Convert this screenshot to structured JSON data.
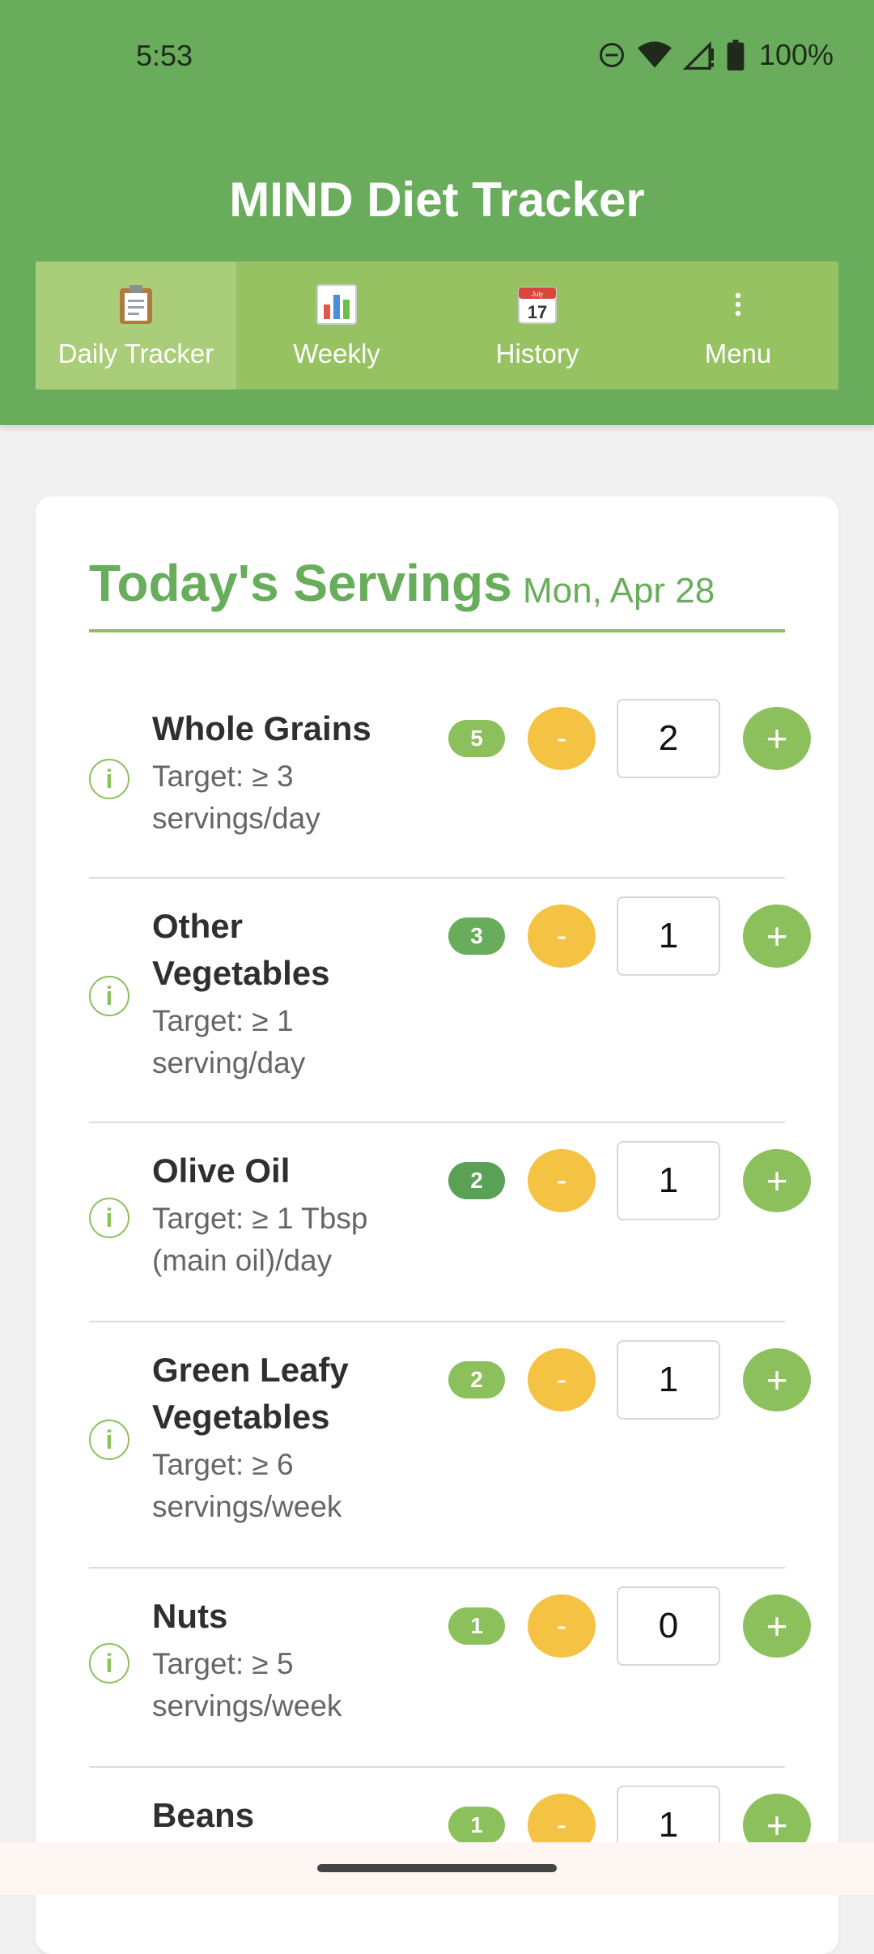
{
  "status_bar": {
    "time": "5:53",
    "battery": "100%"
  },
  "app": {
    "title": "MIND Diet Tracker"
  },
  "tabs": [
    {
      "label": "Daily Tracker",
      "icon": "clipboard-icon"
    },
    {
      "label": "Weekly",
      "icon": "bar-chart-icon"
    },
    {
      "label": "History",
      "icon": "calendar-icon",
      "calendar_month": "July",
      "calendar_day": "17"
    },
    {
      "label": "Menu",
      "icon": "more-vert-icon"
    }
  ],
  "card": {
    "title": "Today's Servings",
    "date": "Mon, Apr 28"
  },
  "foods": [
    {
      "name": "Whole Grains",
      "target": "Target: ≥ 3 servings/day",
      "badge": "5",
      "badge_color": "#8cc05c",
      "quantity": "2"
    },
    {
      "name": "Other Vegetables",
      "target": "Target: ≥ 1 serving/day",
      "badge": "3",
      "badge_color": "#68ad5c",
      "quantity": "1"
    },
    {
      "name": "Olive Oil",
      "target": "Target: ≥ 1 Tbsp (main oil)/day",
      "badge": "2",
      "badge_color": "#58a155",
      "quantity": "1"
    },
    {
      "name": "Green Leafy Vegetables",
      "target": "Target: ≥ 6 servings/week",
      "badge": "2",
      "badge_color": "#8cc05c",
      "quantity": "1"
    },
    {
      "name": "Nuts",
      "target": "Target: ≥ 5 servings/week",
      "badge": "1",
      "badge_color": "#8cc05c",
      "quantity": "0"
    },
    {
      "name": "Beans",
      "target": "",
      "badge": "1",
      "badge_color": "#8cc05c",
      "quantity": "1"
    }
  ],
  "controls": {
    "minus_label": "-",
    "plus_label": "+",
    "info_label": "i"
  },
  "colors": {
    "primary": "#69ad5c",
    "tab_bar": "#96c262",
    "accent_minus": "#f4c343",
    "accent_plus": "#8cc05c"
  }
}
